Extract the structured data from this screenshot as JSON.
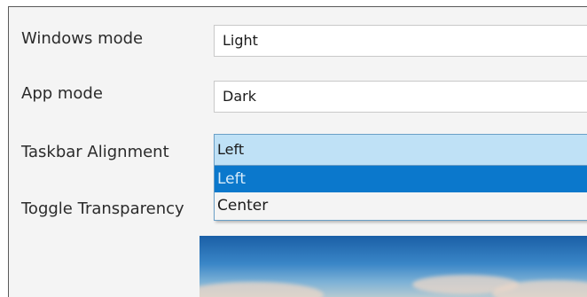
{
  "settings": {
    "windows_mode": {
      "label": "Windows mode",
      "value": "Light"
    },
    "app_mode": {
      "label": "App mode",
      "value": "Dark"
    },
    "taskbar_alignment": {
      "label": "Taskbar Alignment",
      "value": "Left",
      "options": [
        "Left",
        "Center"
      ],
      "highlighted_option": "Left"
    },
    "toggle_transparency": {
      "label": "Toggle Transparency"
    }
  },
  "colors": {
    "focused_field": "#bfe1f6",
    "selected_option": "#0b78cc"
  },
  "preview_image": {
    "icon": "wallpaper-preview-image"
  }
}
